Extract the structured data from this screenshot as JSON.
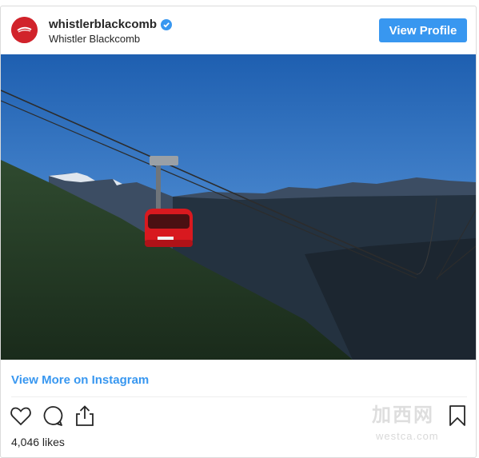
{
  "post": {
    "username": "whistlerblackcomb",
    "full_name": "Whistler Blackcomb",
    "view_profile_label": "View Profile",
    "verified_icon": "verified-badge-icon",
    "image_alt": "Red PEAK 2 PEAK gondola cabin over forested mountain valley",
    "view_more_label": "View More on Instagram",
    "likes_text": "4,046 likes"
  },
  "actions": {
    "like_icon": "heart-icon",
    "comment_icon": "comment-icon",
    "share_icon": "share-icon",
    "save_icon": "bookmark-icon"
  },
  "colors": {
    "accent": "#3897f0",
    "brand": "#d1232b",
    "text": "#262626",
    "border": "#dbdbdb"
  },
  "watermark": {
    "main": "加西网",
    "sub": "westca.com"
  }
}
